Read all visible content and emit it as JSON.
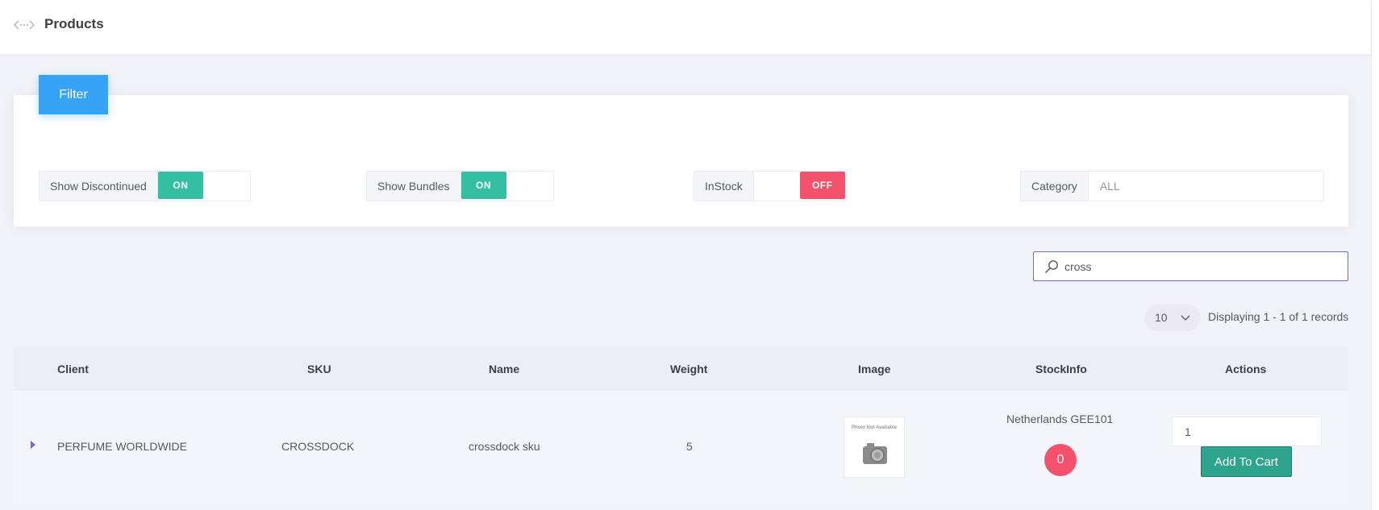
{
  "header": {
    "title": "Products",
    "nav_icon": "expand-arrows-icon"
  },
  "filter": {
    "button_label": "Filter",
    "show_discontinued": {
      "label": "Show Discontinued",
      "state": "ON"
    },
    "show_bundles": {
      "label": "Show Bundles",
      "state": "ON"
    },
    "in_stock": {
      "label": "InStock",
      "state": "OFF"
    },
    "category": {
      "label": "Category",
      "placeholder": "ALL"
    }
  },
  "search": {
    "value": "cross",
    "icon": "search-icon"
  },
  "pagination": {
    "page_size": "10",
    "records_text": "Displaying 1 - 1 of 1 records"
  },
  "table": {
    "columns": [
      "Client",
      "SKU",
      "Name",
      "Weight",
      "Image",
      "StockInfo",
      "Actions"
    ],
    "rows": [
      {
        "client": "PERFUME WORLDWIDE",
        "sku": "CROSSDOCK",
        "name": "crossdock sku",
        "weight": "5",
        "image_caption": "Photo Not Available",
        "stock_location": "Netherlands GEE101",
        "stock_count": "0",
        "qty": "1",
        "action_label": "Add To Cart"
      }
    ]
  },
  "colors": {
    "on": "#34bfa3",
    "off": "#f4516c",
    "primary": "#36a3f7",
    "add_to_cart": "#2fa48c",
    "search_border": "#716aca"
  }
}
